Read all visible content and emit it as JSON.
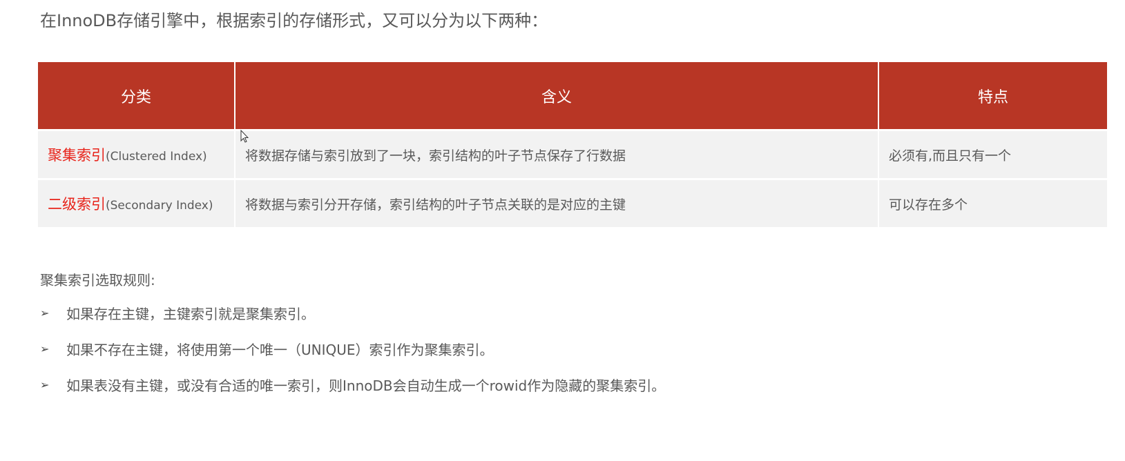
{
  "intro": "在InnoDB存储引擎中，根据索引的存储形式，又可以分为以下两种：",
  "table": {
    "headers": [
      "分类",
      "含义",
      "特点"
    ],
    "rows": [
      {
        "name_cn": "聚集索引",
        "name_en": "(Clustered Index)",
        "meaning": "将数据存储与索引放到了一块，索引结构的叶子节点保存了行数据",
        "feature": "必须有,而且只有一个"
      },
      {
        "name_cn": "二级索引",
        "name_en": "(Secondary Index)",
        "meaning": "将数据与索引分开存储，索引结构的叶子节点关联的是对应的主键",
        "feature": "可以存在多个"
      }
    ]
  },
  "rules": {
    "title": "聚集索引选取规则:",
    "bullet": "➢",
    "items": [
      "如果存在主键，主键索引就是聚集索引。",
      "如果不存在主键，将使用第一个唯一（UNIQUE）索引作为聚集索引。",
      "如果表没有主键，或没有合适的唯一索引，则InnoDB会自动生成一个rowid作为隐藏的聚集索引。"
    ]
  },
  "colors": {
    "header": "#b83625",
    "highlight": "#e8231a",
    "row": "#f2f2f2"
  }
}
